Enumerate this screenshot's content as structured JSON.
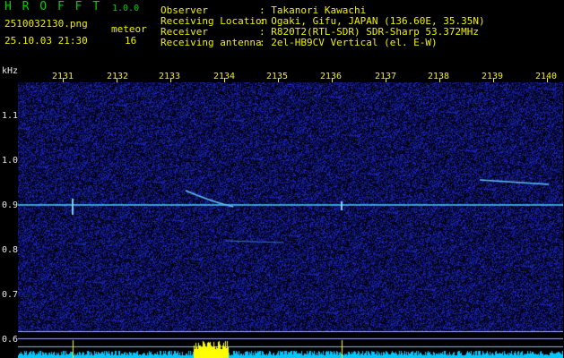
{
  "app": {
    "name": "H R O F F T",
    "version": "1.0.0"
  },
  "file": {
    "name": "2510032130.png",
    "datetime": "25.10.03 21:30"
  },
  "counter": {
    "label": "meteor",
    "value": "16"
  },
  "info": {
    "labels": [
      "Observer",
      "Receiving Location",
      "Receiver",
      "Receiving antenna"
    ],
    "values": [
      ": Takanori Kawachi",
      ": Ogaki, Gifu, JAPAN (136.60E, 35.35N)",
      ": R820T2(RTL-SDR) SDR-Sharp 53.372MHz",
      ": 2el-HB9CV Vertical (el. E-W)"
    ]
  },
  "axes": {
    "y_unit": "kHz",
    "y_ticks": [
      "1.1",
      "1.0",
      "0.9",
      "0.8",
      "0.7",
      "0.6"
    ],
    "x_ticks": [
      "2131",
      "2132",
      "2133",
      "2134",
      "2135",
      "2136",
      "2137",
      "2138",
      "2139",
      "2140"
    ]
  },
  "colors": {
    "header_green": "#00d000",
    "header_yellow": "#f0f000",
    "noise_blue": "#1a2aa0",
    "carrier_cyan": "#40d0ff",
    "audio_level": "#00c8ff",
    "audio_peak": "#ffff00"
  }
}
